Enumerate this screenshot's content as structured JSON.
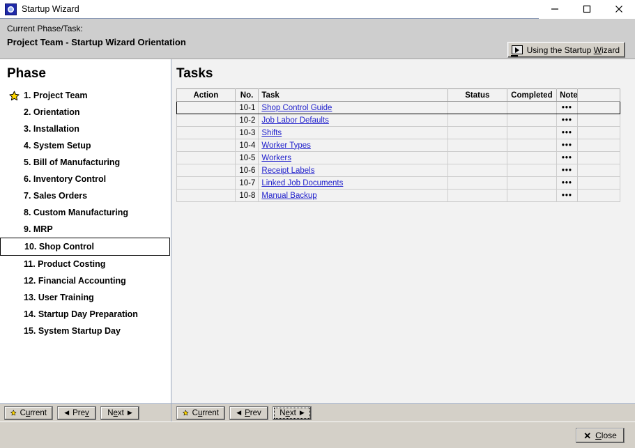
{
  "window": {
    "title": "Startup Wizard",
    "icon": "app-icon",
    "controls": {
      "minimize": "minimize-icon",
      "maximize": "maximize-icon",
      "close": "close-icon"
    }
  },
  "header": {
    "label": "Current Phase/Task:",
    "title": "Project Team  -  Startup Wizard Orientation",
    "help_button": {
      "label_pre": "Using the Startup ",
      "label_accel": "W",
      "label_post": "izard",
      "icon": "video-play-icon"
    }
  },
  "sidebar": {
    "title": "Phase",
    "current_marker_icon": "star-icon",
    "items": [
      {
        "label": "1. Project Team",
        "current": true,
        "selected": false
      },
      {
        "label": "2. Orientation",
        "current": false,
        "selected": false
      },
      {
        "label": "3. Installation",
        "current": false,
        "selected": false
      },
      {
        "label": "4. System Setup",
        "current": false,
        "selected": false
      },
      {
        "label": "5. Bill of Manufacturing",
        "current": false,
        "selected": false
      },
      {
        "label": "6. Inventory Control",
        "current": false,
        "selected": false
      },
      {
        "label": "7. Sales Orders",
        "current": false,
        "selected": false
      },
      {
        "label": "8. Custom Manufacturing",
        "current": false,
        "selected": false
      },
      {
        "label": "9. MRP",
        "current": false,
        "selected": false
      },
      {
        "label": "10. Shop Control",
        "current": false,
        "selected": true
      },
      {
        "label": "11. Product Costing",
        "current": false,
        "selected": false
      },
      {
        "label": "12. Financial Accounting",
        "current": false,
        "selected": false
      },
      {
        "label": "13. User Training",
        "current": false,
        "selected": false
      },
      {
        "label": "14. Startup Day Preparation",
        "current": false,
        "selected": false
      },
      {
        "label": "15. System Startup Day",
        "current": false,
        "selected": false
      }
    ],
    "nav": {
      "current": {
        "pre": "C",
        "accel": "u",
        "post": "rrent",
        "icon": "star-icon"
      },
      "prev": {
        "pre": "Pre",
        "accel": "v",
        "post": "",
        "icon": "arrow-left-icon"
      },
      "next": {
        "pre": "N",
        "accel": "e",
        "post": "xt",
        "icon": "arrow-right-icon"
      },
      "focused": ""
    }
  },
  "main": {
    "title": "Tasks",
    "columns": [
      "Action",
      "No.",
      "Task",
      "Status",
      "Completed",
      "Note",
      ""
    ],
    "rows": [
      {
        "action": "",
        "no": "10-1",
        "task": "Shop Control Guide",
        "status": "",
        "completed": "",
        "note": "•••",
        "extra": "",
        "selected": true
      },
      {
        "action": "",
        "no": "10-2",
        "task": "Job Labor Defaults",
        "status": "",
        "completed": "",
        "note": "•••",
        "extra": "",
        "selected": false
      },
      {
        "action": "",
        "no": "10-3",
        "task": "Shifts",
        "status": "",
        "completed": "",
        "note": "•••",
        "extra": "",
        "selected": false
      },
      {
        "action": "",
        "no": "10-4",
        "task": "Worker Types",
        "status": "",
        "completed": "",
        "note": "•••",
        "extra": "",
        "selected": false
      },
      {
        "action": "",
        "no": "10-5",
        "task": "Workers",
        "status": "",
        "completed": "",
        "note": "•••",
        "extra": "",
        "selected": false
      },
      {
        "action": "",
        "no": "10-6",
        "task": "Receipt Labels",
        "status": "",
        "completed": "",
        "note": "•••",
        "extra": "",
        "selected": false
      },
      {
        "action": "",
        "no": "10-7",
        "task": "Linked Job Documents",
        "status": "",
        "completed": "",
        "note": "•••",
        "extra": "",
        "selected": false
      },
      {
        "action": "",
        "no": "10-8",
        "task": "Manual Backup",
        "status": "",
        "completed": "",
        "note": "•••",
        "extra": "",
        "selected": false
      }
    ],
    "nav": {
      "current": {
        "pre": "C",
        "accel": "u",
        "post": "rrent",
        "icon": "star-icon"
      },
      "prev": {
        "pre": "",
        "accel": "P",
        "post": "rev",
        "icon": "arrow-left-icon"
      },
      "next": {
        "pre": "N",
        "accel": "e",
        "post": "xt",
        "icon": "arrow-right-icon"
      },
      "focused": "next"
    }
  },
  "footer": {
    "close": {
      "pre": "",
      "accel": "C",
      "post": "lose",
      "icon": "x-icon"
    }
  },
  "colors": {
    "link": "#2222cc",
    "chrome": "#d4d0c8",
    "header_band": "#cecece",
    "panel_bg": "#f2f2f2",
    "star": "#ffd700"
  }
}
